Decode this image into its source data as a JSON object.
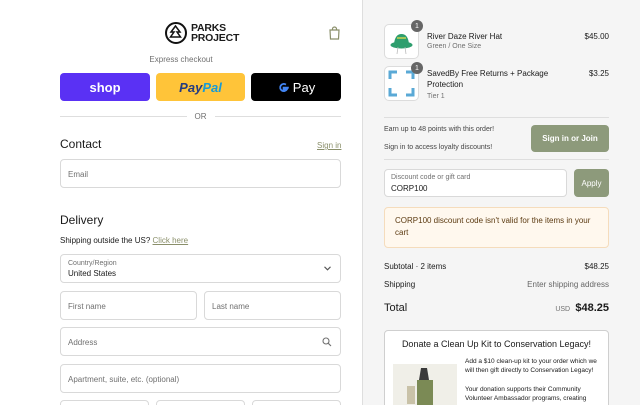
{
  "brand": {
    "line1": "PARKS",
    "line2": "PROJECT"
  },
  "express": {
    "label": "Express checkout",
    "shop": "shop",
    "paypal_a": "Pay",
    "paypal_b": "Pal",
    "gpay": "Pay",
    "or": "OR"
  },
  "contact": {
    "title": "Contact",
    "signin": "Sign in",
    "email_placeholder": "Email"
  },
  "delivery": {
    "title": "Delivery",
    "shipping_outside": "Shipping outside the US?",
    "click_here": "Click here",
    "country_label": "Country/Region",
    "country_value": "United States",
    "first_name": "First name",
    "last_name": "Last name",
    "address": "Address",
    "apartment": "Apartment, suite, etc. (optional)"
  },
  "cart": {
    "items": [
      {
        "name": "River Daze River Hat",
        "variant": "Green / One Size",
        "price": "$45.00",
        "qty": "1"
      },
      {
        "name": "SavedBy Free Returns + Package Protection",
        "variant": "Tier 1",
        "price": "$3.25",
        "qty": "1"
      }
    ]
  },
  "loyalty": {
    "line1": "Earn up to 48 points with this order!",
    "line2": "Sign in to access loyalty discounts!",
    "button": "Sign in or Join"
  },
  "discount": {
    "label": "Discount code or gift card",
    "value": "CORP100",
    "apply": "Apply",
    "error": "CORP100 discount code isn't valid for the items in your cart"
  },
  "summary": {
    "subtotal_label": "Subtotal · 2 items",
    "subtotal_value": "$48.25",
    "shipping_label": "Shipping",
    "shipping_value": "Enter shipping address",
    "total_label": "Total",
    "currency": "USD",
    "total_value": "$48.25"
  },
  "donation": {
    "title": "Donate a Clean Up Kit to Conservation Legacy!",
    "text1": "Add a $10 clean-up kit to your order which we will then gift directly to Conservation Legacy!",
    "text2": "Your donation supports their Community Volunteer Ambassador programs, creating"
  },
  "colors": {
    "shop": "#5a31f4",
    "paypal": "#ffc439",
    "olive": "#8d9a7b",
    "warn_bg": "#fff8ee"
  }
}
